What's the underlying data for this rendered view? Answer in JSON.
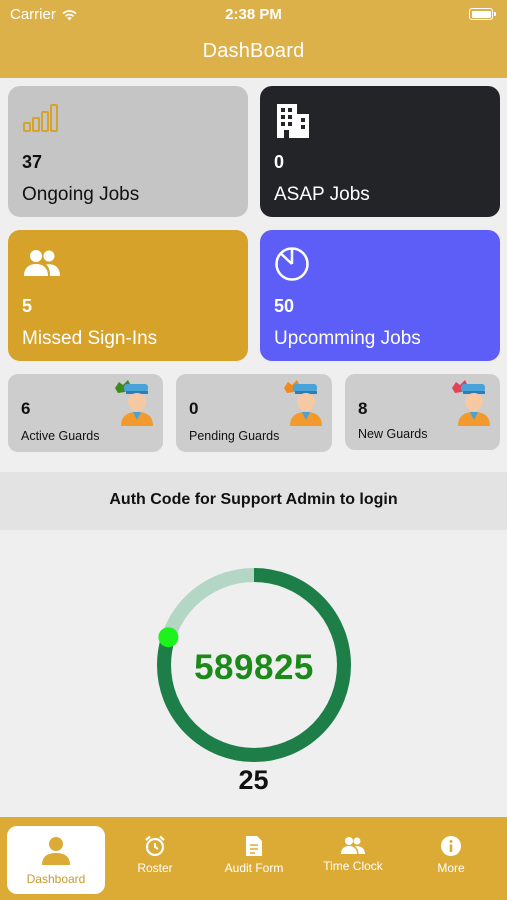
{
  "status_bar": {
    "carrier": "Carrier",
    "time": "2:38 PM"
  },
  "header": {
    "title": "DashBoard"
  },
  "cards": [
    {
      "count": "37",
      "label": "Ongoing Jobs",
      "icon": "signal-bars-icon"
    },
    {
      "count": "0",
      "label": "ASAP Jobs",
      "icon": "building-icon"
    },
    {
      "count": "5",
      "label": "Missed Sign-Ins",
      "icon": "people-icon"
    },
    {
      "count": "50",
      "label": "Upcomming Jobs",
      "icon": "pie-chart-icon"
    }
  ],
  "guards": [
    {
      "count": "6",
      "label": "Active Guards",
      "icon": "guard-icon"
    },
    {
      "count": "0",
      "label": "Pending Guards",
      "icon": "guard-icon"
    },
    {
      "count": "8",
      "label": "New Guards",
      "icon": "guard-icon"
    }
  ],
  "auth": {
    "title": "Auth Code for Support Admin to login",
    "code": "589825",
    "seconds_remaining": "25",
    "progress_fraction": 0.8
  },
  "tabs": [
    {
      "label": "Dashboard",
      "icon": "person-icon",
      "active": true
    },
    {
      "label": "Roster",
      "icon": "alarm-clock-icon"
    },
    {
      "label": "Audit Form",
      "icon": "document-icon"
    },
    {
      "label": "Time Clock",
      "icon": "people-icon"
    },
    {
      "label": "More",
      "icon": "info-icon"
    }
  ],
  "colors": {
    "brand": "#ddb14a",
    "ring_progress": "#1e7e48",
    "ring_track": "#b3d6c5",
    "code": "#1b8a19"
  }
}
